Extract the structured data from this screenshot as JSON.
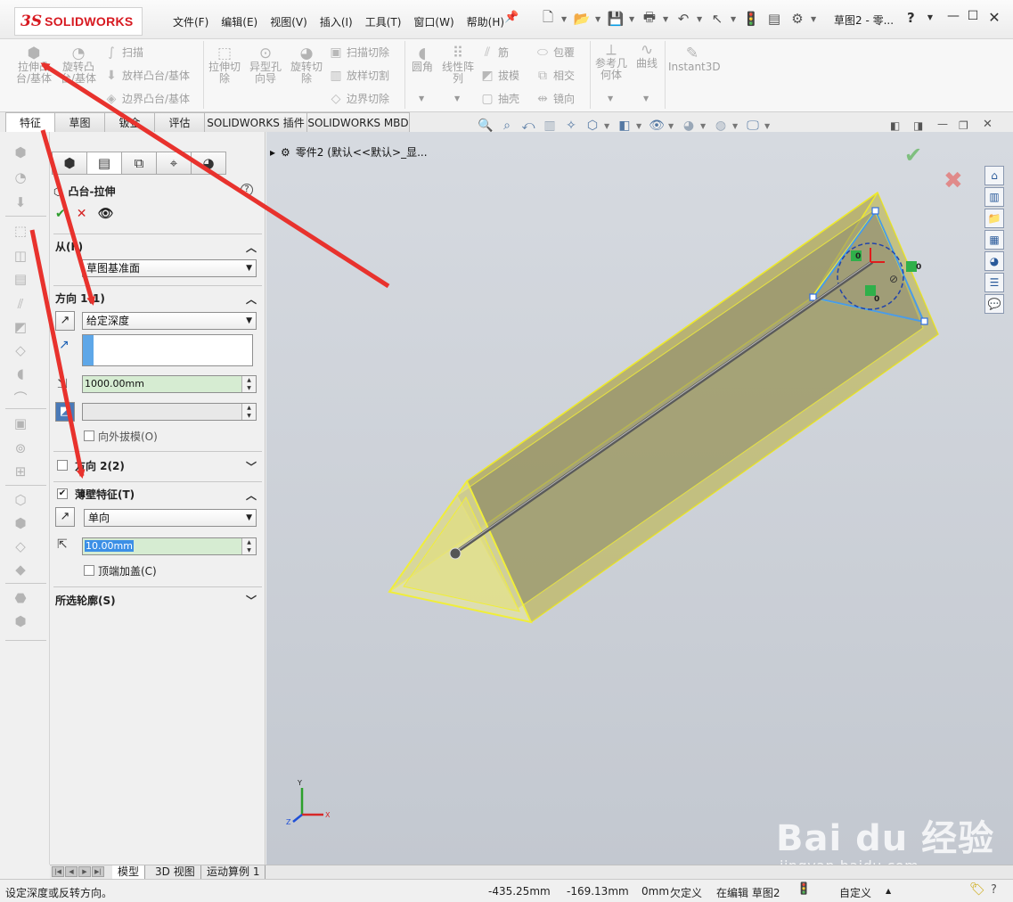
{
  "app": {
    "logo_mark": "3S",
    "logo_text": "SOLIDWORKS",
    "document_title": "草图2 - 零...",
    "menu": [
      "文件(F)",
      "编辑(E)",
      "视图(V)",
      "插入(I)",
      "工具(T)",
      "窗口(W)",
      "帮助(H)"
    ]
  },
  "ribbon": {
    "big_buttons": [
      {
        "label1": "拉伸凸",
        "label2": "台/基体"
      },
      {
        "label1": "旋转凸",
        "label2": "台/基体"
      },
      {
        "label1": "拉伸切",
        "label2": "除"
      },
      {
        "label1": "异型孔",
        "label2": "向导"
      },
      {
        "label1": "旋转切",
        "label2": "除"
      },
      {
        "label1": "圆角",
        "label2": ""
      },
      {
        "label1": "线性阵",
        "label2": "列"
      },
      {
        "label1": "参考几",
        "label2": "何体"
      },
      {
        "label1": "曲线",
        "label2": ""
      },
      {
        "label1": "Instant3D",
        "label2": ""
      }
    ],
    "small_buttons": [
      "扫描",
      "放样凸台/基体",
      "边界凸台/基体",
      "扫描切除",
      "放样切割",
      "边界切除",
      "筋",
      "拔模",
      "抽壳",
      "包覆",
      "相交",
      "镜向"
    ]
  },
  "tabs": [
    "特征",
    "草图",
    "钣金",
    "评估",
    "SOLIDWORKS 插件",
    "SOLIDWORKS MBD"
  ],
  "property_manager": {
    "title": "凸台-拉伸",
    "sections": {
      "from": {
        "label": "从(F)",
        "value": "草图基准面"
      },
      "direction1": {
        "label": "方向 1(1)",
        "end_condition": "给定深度",
        "depth": "1000.00mm",
        "draft_label": "向外拔模(O)"
      },
      "direction2": {
        "label": "方向 2(2)"
      },
      "thin_feature": {
        "label": "薄壁特征(T)",
        "type": "单向",
        "thickness": "10.00mm",
        "cap_label": "顶端加盖(C)"
      },
      "contours": {
        "label": "所选轮廓(S)"
      }
    }
  },
  "viewport": {
    "tree_label": "零件2  (默认<<默认>_显...",
    "relation_tags": [
      "0",
      "0",
      "0",
      "0",
      "0"
    ],
    "triad": {
      "x": "X",
      "y": "Y",
      "z": "Z"
    }
  },
  "bottom_tabs": [
    "模型",
    "3D 视图",
    "运动算例 1"
  ],
  "status": {
    "hint": "设定深度或反转方向。",
    "x": "-435.25mm",
    "y": "-169.13mm",
    "z": "0mm",
    "define_state": "欠定义",
    "edit_state": "在编辑 草图2",
    "units": "自定义"
  },
  "watermark": {
    "logo": "Bai du 经验",
    "url": "jingyan.baidu.com"
  },
  "colors": {
    "brand_red": "#d71920",
    "annotation_arrow": "#e8322d",
    "thin_wall_yellow": "#f0ee3a",
    "sketch_blue": "#2f6fe0",
    "active_input_green": "#d6ecd2"
  }
}
